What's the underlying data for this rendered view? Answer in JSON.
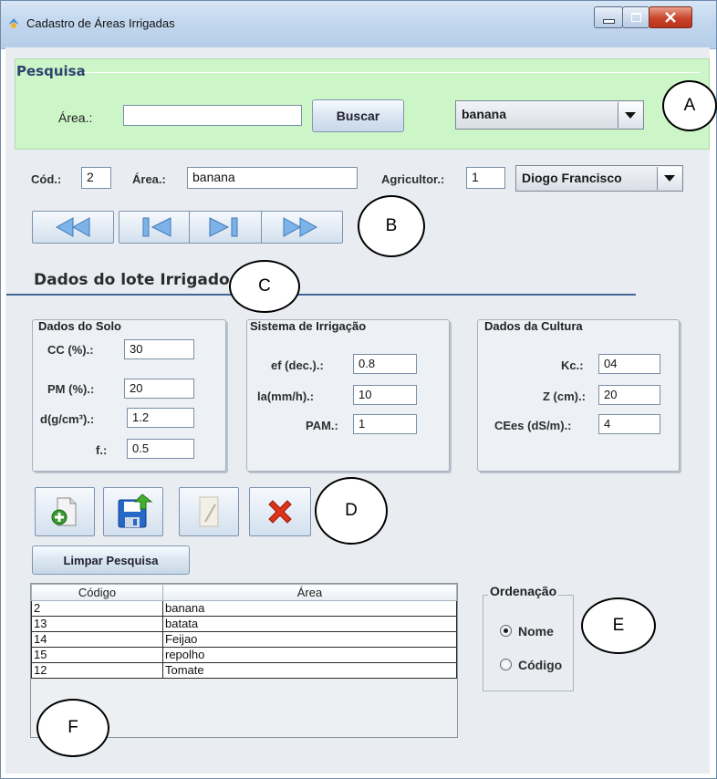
{
  "window": {
    "title": "Cadastro de Áreas Irrigadas",
    "controls": [
      "minimize",
      "maximize",
      "close"
    ]
  },
  "search": {
    "section_title": "Pesquisa",
    "area_label": "Área.:",
    "area_value": "",
    "search_button": "Buscar",
    "combo_value": "banana"
  },
  "record": {
    "cod_label": "Cód.:",
    "cod_value": "2",
    "area_label": "Área.:",
    "area_value": "banana",
    "farmer_label": "Agricultor.:",
    "farmer_id": "1",
    "farmer_name": "Diogo Francisco"
  },
  "nav_buttons": [
    "first-icon",
    "previous-icon",
    "next-icon",
    "last-icon"
  ],
  "lot": {
    "title": "Dados do lote Irrigado",
    "soil": {
      "title": "Dados do Solo",
      "cc_label": "CC (%).:",
      "cc_value": "30",
      "pm_label": "PM (%).:",
      "pm_value": "20",
      "d_label": "d(g/cm³).:",
      "d_value": "1.2",
      "f_label": "f.:",
      "f_value": "0.5"
    },
    "irrigation": {
      "title": "Sistema de Irrigação",
      "ef_label": "ef (dec.).:",
      "ef_value": "0.8",
      "la_label": "la(mm/h).:",
      "la_value": "10",
      "pam_label": "PAM.:",
      "pam_value": "1"
    },
    "crop": {
      "title": "Dados da Cultura",
      "kc_label": "Kc.:",
      "kc_value": "04",
      "z_label": "Z (cm).:",
      "z_value": "20",
      "cees_label": "CEes (dS/m).:",
      "cees_value": "4"
    }
  },
  "toolbar": {
    "icons": [
      "new-icon",
      "save-icon",
      "edit-icon",
      "delete-icon"
    ],
    "clear_button": "Limpar Pesquisa"
  },
  "table": {
    "columns": [
      "Código",
      "Área"
    ],
    "rows": [
      [
        "2",
        "banana"
      ],
      [
        "13",
        "batata"
      ],
      [
        "14",
        "Feijao"
      ],
      [
        "15",
        "repolho"
      ],
      [
        "12",
        "Tomate"
      ]
    ]
  },
  "ordering": {
    "title": "Ordenação",
    "options": [
      "Nome",
      "Código"
    ],
    "selected": "Nome"
  },
  "annotations": [
    "A",
    "B",
    "C",
    "D",
    "E",
    "F"
  ],
  "colors": {
    "search_panel_bg": "#ccf5c8",
    "title_accent": "#2f4270",
    "delete_red": "#e0331a",
    "save_blue": "#2469c8"
  }
}
